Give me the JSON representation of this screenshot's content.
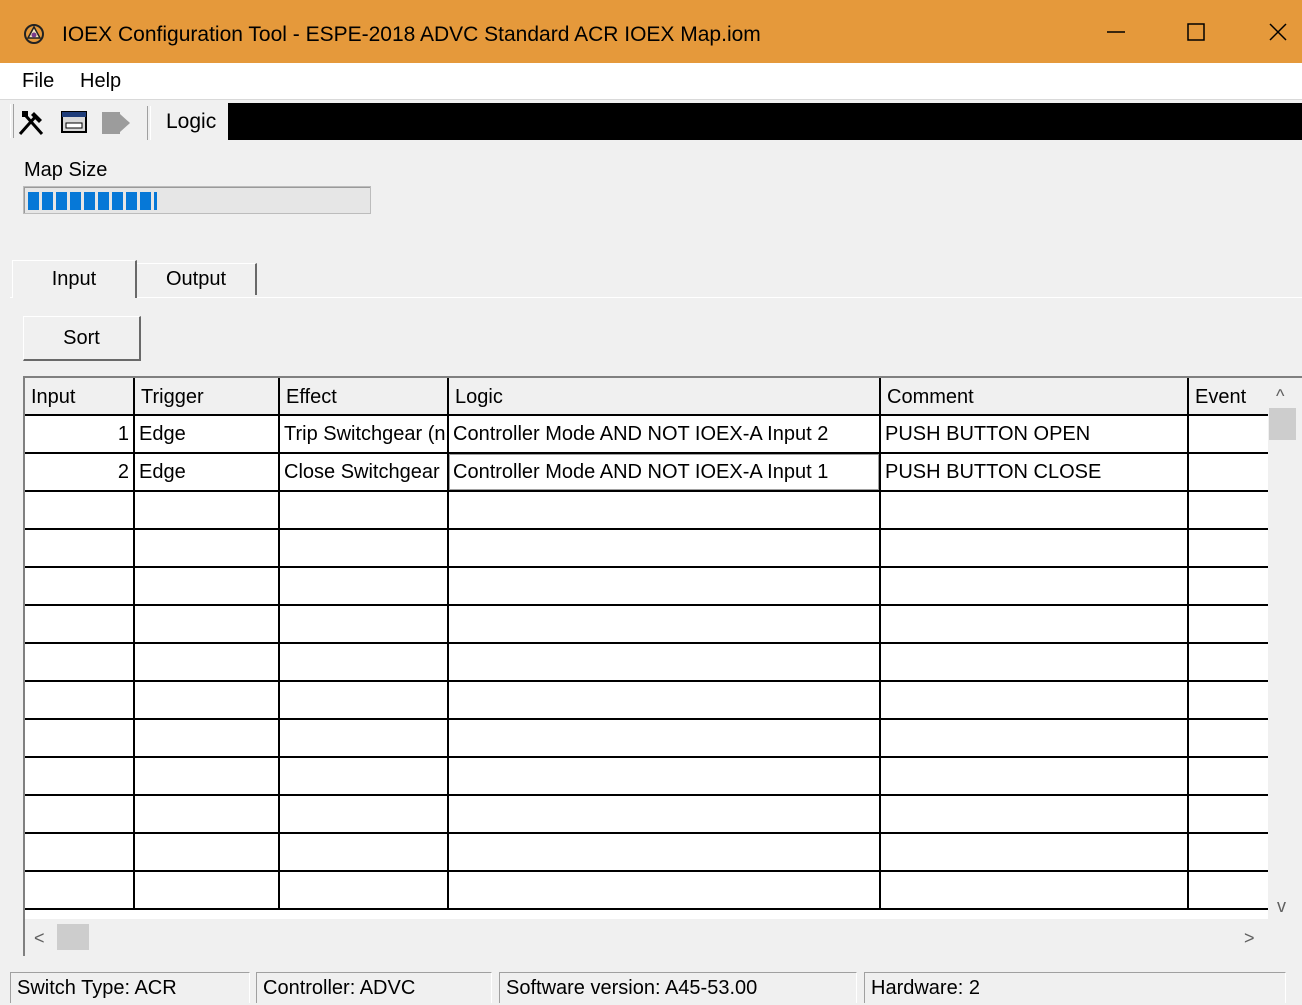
{
  "window": {
    "title": "IOEX Configuration Tool - ESPE-2018 ADVC Standard ACR IOEX Map.iom",
    "app_icon": "ioex-app-icon",
    "title_bar_color": "#e5993b",
    "controls": {
      "minimize": "—",
      "maximize": "☐",
      "close": "✕"
    }
  },
  "menu": {
    "items": [
      "File",
      "Help"
    ]
  },
  "toolbar": {
    "icons": [
      "tools-icon",
      "card-icon",
      "export-icon"
    ],
    "label": "Logic"
  },
  "map_size": {
    "label": "Map Size",
    "progress_fraction": 0.38,
    "fill_color": "#0678d7"
  },
  "tabs": {
    "input": "Input",
    "output": "Output",
    "active": "Input"
  },
  "sort_button": "Sort",
  "grid": {
    "columns": [
      "Input",
      "Trigger",
      "Effect",
      "Logic",
      "Comment",
      "Event"
    ],
    "rows": [
      [
        "1",
        "Edge",
        "Trip Switchgear (n",
        "Controller Mode AND NOT IOEX-A Input 2",
        "PUSH  BUTTON OPEN",
        ""
      ],
      [
        "2",
        "Edge",
        "Close Switchgear",
        "Controller Mode AND NOT IOEX-A Input 1",
        "PUSH  BUTTON CLOSE",
        ""
      ]
    ],
    "empty_rows": 11
  },
  "scrollbars": {
    "up": "^",
    "down": "v",
    "left": "<",
    "right": ">"
  },
  "status": {
    "switch_type": "Switch Type: ACR",
    "controller": "Controller: ADVC",
    "software_version": "Software version: A45-53.00",
    "hardware": "Hardware: 2"
  }
}
